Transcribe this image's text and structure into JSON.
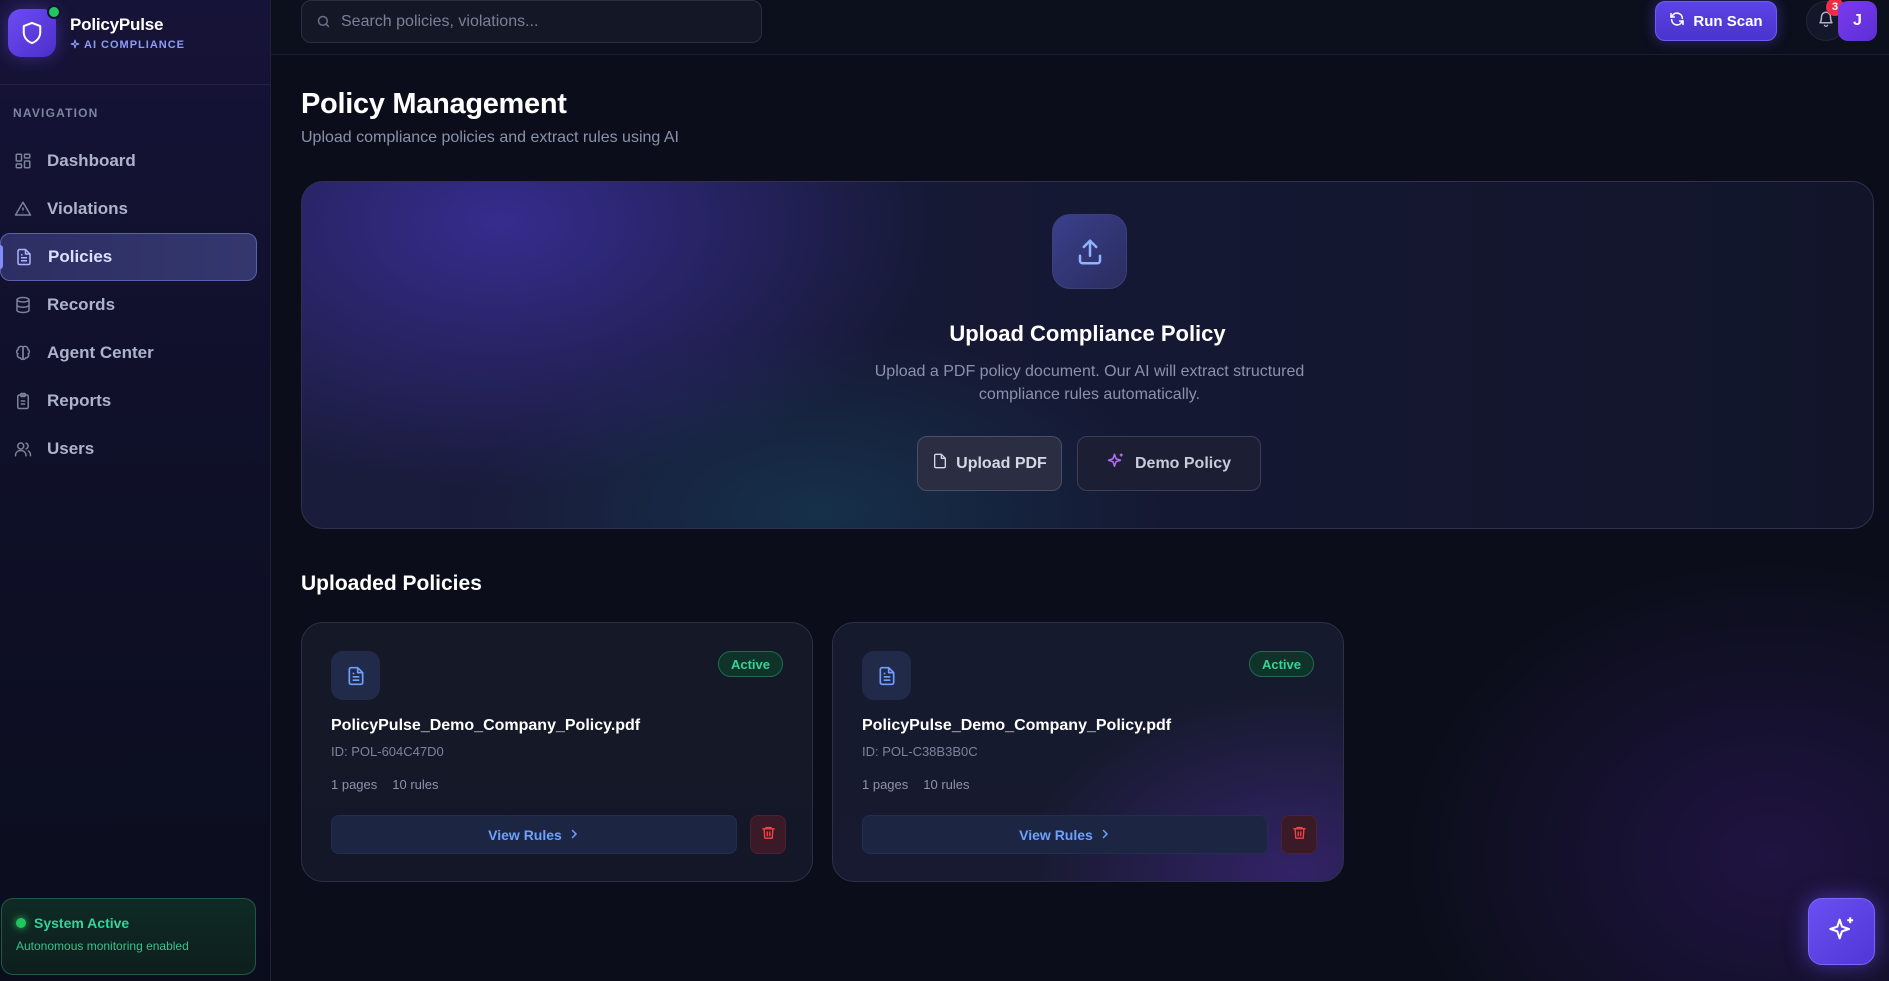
{
  "app": {
    "name": "PolicyPulse",
    "tagline": "AI COMPLIANCE"
  },
  "sidebar": {
    "heading": "NAVIGATION",
    "items": [
      {
        "label": "Dashboard",
        "icon": "grid-icon",
        "active": false
      },
      {
        "label": "Violations",
        "icon": "alert-triangle-icon",
        "active": false
      },
      {
        "label": "Policies",
        "icon": "file-text-icon",
        "active": true
      },
      {
        "label": "Records",
        "icon": "database-icon",
        "active": false
      },
      {
        "label": "Agent Center",
        "icon": "brain-icon",
        "active": false
      },
      {
        "label": "Reports",
        "icon": "clipboard-icon",
        "active": false
      },
      {
        "label": "Users",
        "icon": "users-icon",
        "active": false
      }
    ],
    "status": {
      "title": "System Active",
      "subtitle": "Autonomous monitoring enabled"
    }
  },
  "topbar": {
    "search_placeholder": "Search policies, violations...",
    "run_scan_label": "Run Scan",
    "notification_count": "3",
    "avatar_initial": "J"
  },
  "page": {
    "title": "Policy Management",
    "subtitle": "Upload compliance policies and extract rules using AI"
  },
  "upload": {
    "title": "Upload Compliance Policy",
    "description": "Upload a PDF policy document. Our AI will extract structured compliance rules automatically.",
    "upload_button": "Upload PDF",
    "demo_button": "Demo Policy"
  },
  "policies": {
    "section_title": "Uploaded Policies",
    "items": [
      {
        "status": "Active",
        "filename": "PolicyPulse_Demo_Company_Policy.pdf",
        "id": "ID: POL-604C47D0",
        "pages": "1 pages",
        "rules": "10 rules",
        "view_label": "View Rules"
      },
      {
        "status": "Active",
        "filename": "PolicyPulse_Demo_Company_Policy.pdf",
        "id": "ID: POL-C38B3B0C",
        "pages": "1 pages",
        "rules": "10 rules",
        "view_label": "View Rules"
      }
    ]
  },
  "colors": {
    "accent": "#5b43e6",
    "success": "#34d399",
    "danger": "#ef4444",
    "link": "#6ea0ff"
  }
}
